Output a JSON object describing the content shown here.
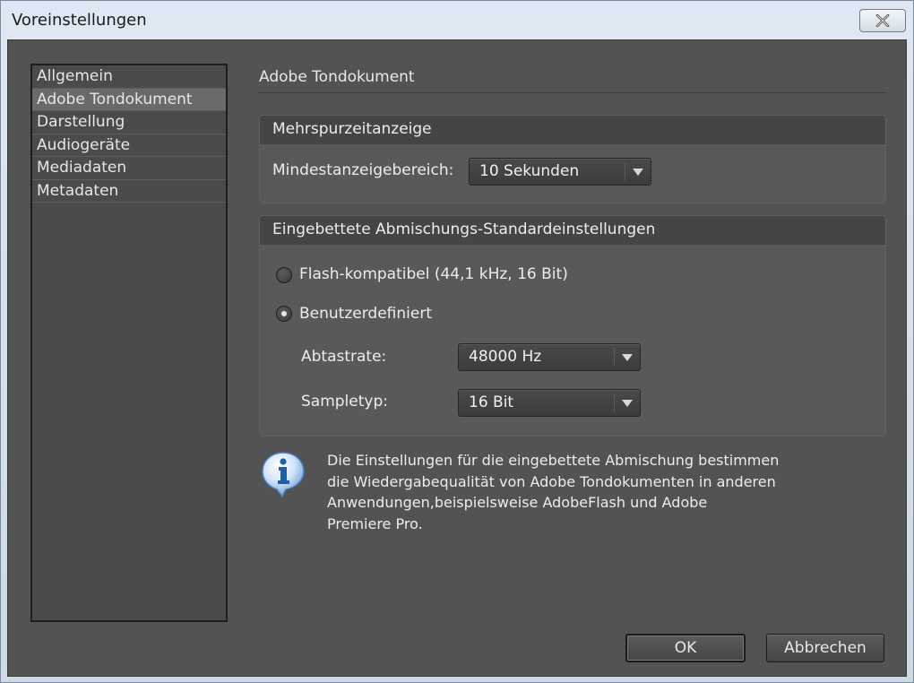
{
  "window": {
    "title": "Voreinstellungen",
    "close_icon": "close-icon"
  },
  "sidebar": {
    "items": [
      {
        "label": "Allgemein",
        "selected": false
      },
      {
        "label": "Adobe Tondokument",
        "selected": true
      },
      {
        "label": "Darstellung",
        "selected": false
      },
      {
        "label": "Audiogeräte",
        "selected": false
      },
      {
        "label": "Mediadaten",
        "selected": false
      },
      {
        "label": "Metadaten",
        "selected": false
      }
    ]
  },
  "main": {
    "heading": "Adobe Tondokument",
    "multitrack": {
      "header": "Mehrspurzeitanzeige",
      "min_range_label": "Mindestanzeigebereich:",
      "min_range_value": "10 Sekunden"
    },
    "mixdown": {
      "header": "Eingebettete Abmischungs-Standardeinstellungen",
      "option_flash": "Flash-kompatibel (44,1 kHz, 16 Bit)",
      "option_custom": "Benutzerdefiniert",
      "selected_option": "custom",
      "sample_rate_label": "Abtastrate:",
      "sample_rate_value": "48000 Hz",
      "sample_type_label": "Sampletyp:",
      "sample_type_value": "16 Bit"
    },
    "info": {
      "icon": "info-icon",
      "lines": [
        "Die Einstellungen für die eingebettete Abmischung bestimmen",
        "die Wiedergabequalität von Adobe Tondokumenten in anderen",
        "Anwendungen,beispielsweise AdobeFlash und Adobe",
        "Premiere Pro."
      ]
    }
  },
  "footer": {
    "ok_label": "OK",
    "cancel_label": "Abbrechen"
  },
  "colors": {
    "panel_bg": "#535353",
    "group_header_bg": "#454545",
    "text": "#ececec",
    "titlebar": "#dfe8f2"
  }
}
